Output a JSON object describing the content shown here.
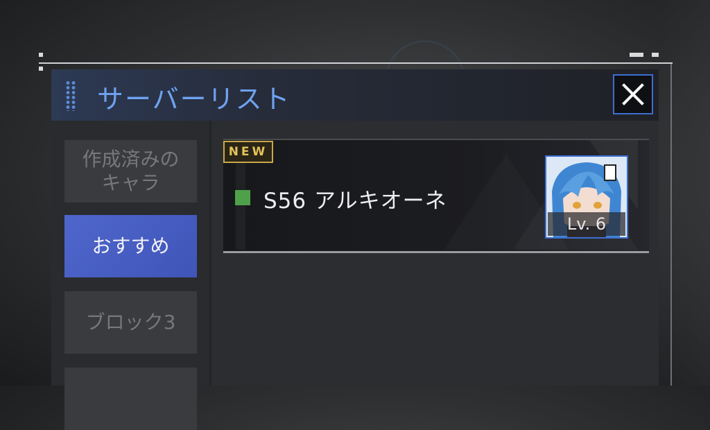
{
  "dialog": {
    "title": "サーバーリスト",
    "close_label": "close"
  },
  "sidebar": {
    "tabs": [
      {
        "label": "作成済みの\nキャラ",
        "active": false
      },
      {
        "label": "おすすめ",
        "active": true
      },
      {
        "label": "ブロック3",
        "active": false
      },
      {
        "label": "",
        "active": false
      }
    ]
  },
  "servers": [
    {
      "badge": "NEW",
      "name": "S56 アルキオーネ",
      "status_color": "#4fa04a",
      "level": "Lv. 6",
      "avatar_icon": "character-portrait-icon"
    }
  ],
  "colors": {
    "accent": "#3d6fd1",
    "title": "#6fa2f0",
    "active_tab": "#4a60c6",
    "badge": "#c9a94a"
  }
}
